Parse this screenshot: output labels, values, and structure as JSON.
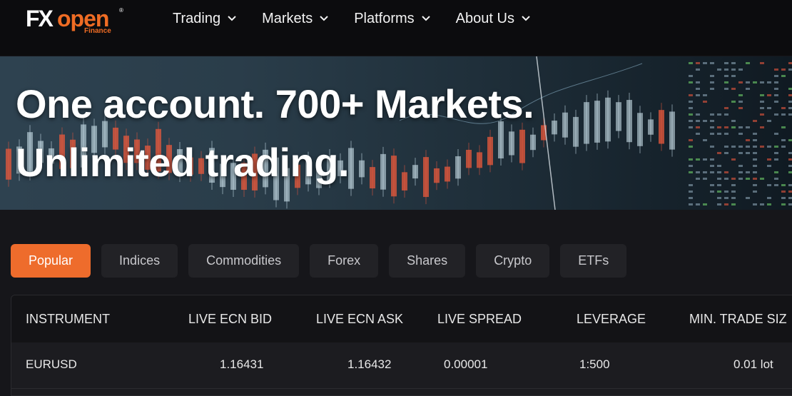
{
  "brand": {
    "logo_fx": "FX",
    "logo_open": "open",
    "logo_finance": "Finance",
    "logo_reg": "®"
  },
  "nav": {
    "items": [
      {
        "label": "Trading",
        "icon": "chevron-down-icon"
      },
      {
        "label": "Markets",
        "icon": "chevron-down-icon"
      },
      {
        "label": "Platforms",
        "icon": "chevron-down-icon"
      },
      {
        "label": "About Us",
        "icon": "chevron-down-icon"
      }
    ]
  },
  "hero": {
    "line1": "One account. 700+ Markets.",
    "line2": "Unlimited trading."
  },
  "tabs": {
    "items": [
      "Popular",
      "Indices",
      "Commodities",
      "Forex",
      "Shares",
      "Crypto",
      "ETFs"
    ],
    "active": "Popular"
  },
  "table": {
    "headers": [
      "INSTRUMENT",
      "LIVE ECN BID",
      "LIVE ECN ASK",
      "LIVE SPREAD",
      "LEVERAGE",
      "MIN. TRADE SIZ"
    ],
    "rows": [
      [
        "EURUSD",
        "1.16431",
        "1.16432",
        "0.00001",
        "1:500",
        "0.01 lot"
      ]
    ]
  },
  "colors": {
    "accent": "#ee6c2c",
    "background": "#16161a",
    "header": "#0c0c0e"
  }
}
